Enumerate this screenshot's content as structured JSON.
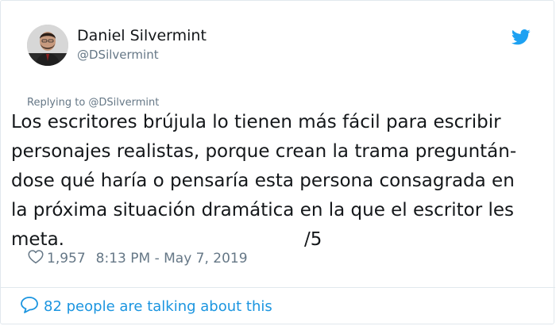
{
  "author": {
    "name": "Daniel Silvermint",
    "handle": "@DSilvermint"
  },
  "icons": {
    "platform": "twitter-bird-icon",
    "like": "heart-outline-icon",
    "reply": "speech-bubble-icon"
  },
  "colors": {
    "twitter_blue": "#1da1f2",
    "link_blue": "#1b95e0",
    "secondary_text": "#657786"
  },
  "tweet": {
    "replying_to": "Replying to @DSilvermint",
    "lines": [
      "Los escritores brújula lo tienen más fácil para escribir",
      "personajes realistas, porque crean la trama preguntán-",
      "dose qué haría o pensaría esta persona consagrada en",
      "la próxima situación dramática en la que el escritor les",
      "meta."
    ],
    "thread_marker": "/5",
    "likes": "1,957",
    "timestamp": "8:13 PM - May 7, 2019"
  },
  "footer": {
    "talking_text": "82 people are talking about this"
  }
}
